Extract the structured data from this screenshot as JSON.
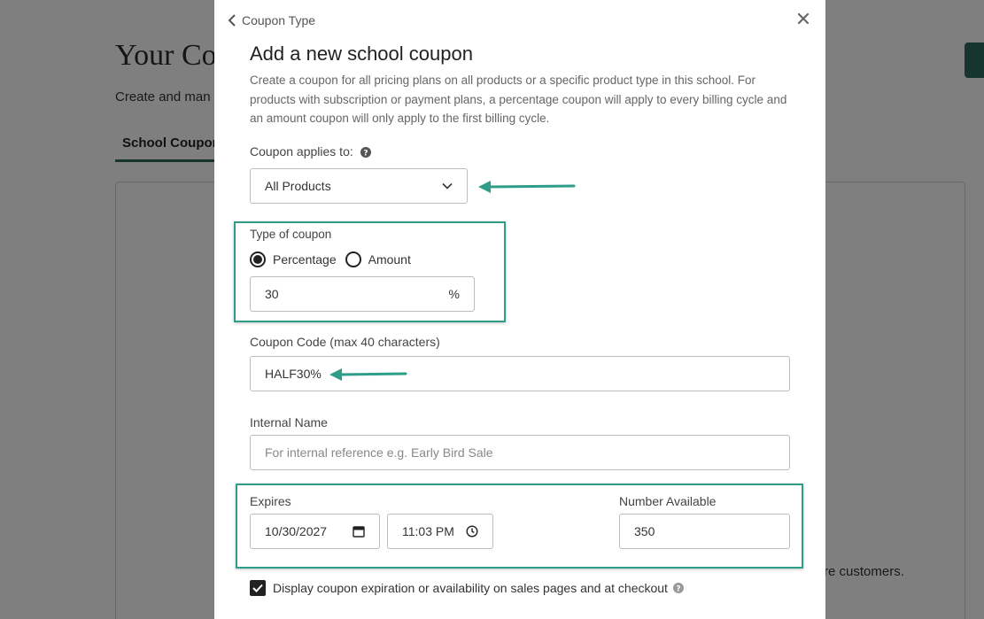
{
  "background": {
    "title": "Your Co",
    "subtitle": "Create and man",
    "tab": "School Coupon",
    "footer_text": "re customers."
  },
  "modal": {
    "back_label": "Coupon Type",
    "title": "Add a new school coupon",
    "description": "Create a coupon for all pricing plans on all products or a specific product type in this school. For products with subscription or payment plans, a percentage coupon will apply to every billing cycle and an amount coupon will only apply to the first billing cycle.",
    "applies_to": {
      "label": "Coupon applies to:",
      "selected": "All Products"
    },
    "coupon_type": {
      "label": "Type of coupon",
      "options": [
        "Percentage",
        "Amount"
      ],
      "selected": "Percentage",
      "value": "30",
      "unit": "%"
    },
    "coupon_code": {
      "label": "Coupon Code (max 40 characters)",
      "value": "HALF30%"
    },
    "internal_name": {
      "label": "Internal Name",
      "placeholder": "For internal reference e.g. Early Bird Sale"
    },
    "expires": {
      "label": "Expires",
      "date": "10/30/2027",
      "time": "11:03 PM"
    },
    "number_available": {
      "label": "Number Available",
      "value": "350"
    },
    "display_checkbox": {
      "label": "Display coupon expiration or availability on sales pages and at checkout",
      "checked": true
    }
  },
  "colors": {
    "annotation": "#2e9e89",
    "brand": "#2c6b5c"
  }
}
